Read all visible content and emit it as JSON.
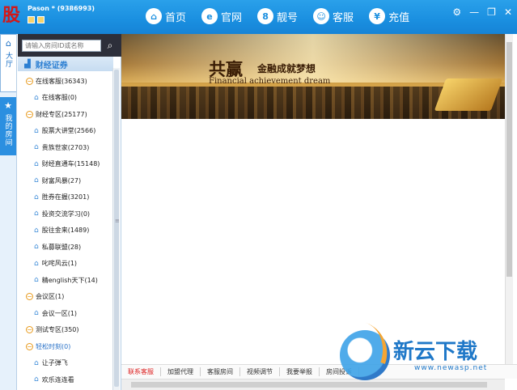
{
  "app": {
    "logo_char": "股",
    "user": "Pason * (9386993)"
  },
  "nav": [
    {
      "label": "首页",
      "icon": "home-icon",
      "glyph": "⌂"
    },
    {
      "label": "官网",
      "icon": "browser-e-icon",
      "glyph": "e"
    },
    {
      "label": "靓号",
      "icon": "number-8-icon",
      "glyph": "8"
    },
    {
      "label": "客服",
      "icon": "support-agent-icon",
      "glyph": "☺"
    },
    {
      "label": "充值",
      "icon": "yen-icon",
      "glyph": "¥"
    }
  ],
  "rail": {
    "hall": "大厅",
    "my_rooms": "我的房间"
  },
  "search": {
    "placeholder": "请输入房间ID或名称"
  },
  "category": "财经证券",
  "tree": [
    {
      "type": "group",
      "label": "在线客服(36343)"
    },
    {
      "type": "child",
      "label": "在线客服(0)"
    },
    {
      "type": "group",
      "label": "财经专区(25177)"
    },
    {
      "type": "child",
      "label": "股票大讲堂(2566)"
    },
    {
      "type": "child",
      "label": "贵族世家(2703)"
    },
    {
      "type": "child",
      "label": "财经直通车(15148)"
    },
    {
      "type": "child",
      "label": "财富风暴(27)"
    },
    {
      "type": "child",
      "label": "胜券在握(3201)"
    },
    {
      "type": "child",
      "label": "投资交流学习(0)"
    },
    {
      "type": "child",
      "label": "股往金来(1489)"
    },
    {
      "type": "child",
      "label": "私募联盟(28)"
    },
    {
      "type": "child",
      "label": "叱咤风云(1)"
    },
    {
      "type": "child",
      "label": "精english天下(14)"
    },
    {
      "type": "group",
      "label": "会议区(1)"
    },
    {
      "type": "child",
      "label": "会议一区(1)"
    },
    {
      "type": "group",
      "label": "测试专区(350)"
    },
    {
      "type": "group",
      "label": "轻松时刻(0)",
      "blue": true
    },
    {
      "type": "child",
      "label": "让子弹飞"
    },
    {
      "type": "child",
      "label": "欢乐连连看"
    }
  ],
  "banner": {
    "title_cn": "共赢",
    "title_cn_sub": "金融成就梦想",
    "title_en": "Financial achievement dream"
  },
  "bottom_links": [
    "联系客服",
    "加盟代理",
    "客服房间",
    "视频调节",
    "我要举报",
    "房间投诉"
  ],
  "watermark": {
    "text": "新云下载",
    "url": "www.newasp.net"
  }
}
